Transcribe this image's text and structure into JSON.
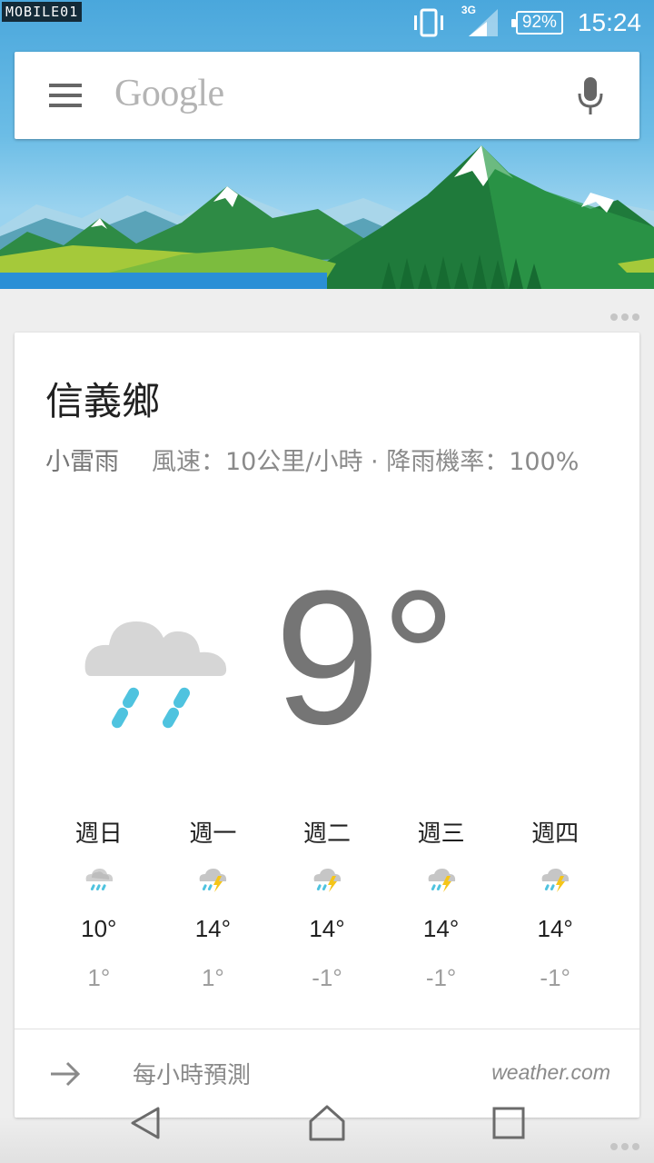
{
  "status_bar": {
    "watermark": "MOBILE01",
    "network": "3G",
    "battery": "92%",
    "time": "15:24"
  },
  "search": {
    "logo": "Google",
    "menu_icon": "menu-icon",
    "mic_icon": "mic-icon"
  },
  "weather": {
    "location": "信義鄉",
    "condition": "小雷雨",
    "details": "風速：10公里/小時 · 降雨機率：100%",
    "temperature": "9°",
    "icon": "rain-cloud-icon",
    "forecast": [
      {
        "day": "週日",
        "icon": "rain-cloud-icon",
        "high": "10°",
        "low": "1°"
      },
      {
        "day": "週一",
        "icon": "thunderstorm-icon",
        "high": "14°",
        "low": "1°"
      },
      {
        "day": "週二",
        "icon": "thunderstorm-icon",
        "high": "14°",
        "low": "-1°"
      },
      {
        "day": "週三",
        "icon": "thunderstorm-icon",
        "high": "14°",
        "low": "-1°"
      },
      {
        "day": "週四",
        "icon": "thunderstorm-icon",
        "high": "14°",
        "low": "-1°"
      }
    ],
    "footer": {
      "label": "每小時預測",
      "source": "weather.com"
    }
  },
  "colors": {
    "rain": "#4fc3df",
    "cloud": "#d6d6d6",
    "bolt": "#f5c518",
    "sky": "#6cbde6"
  }
}
